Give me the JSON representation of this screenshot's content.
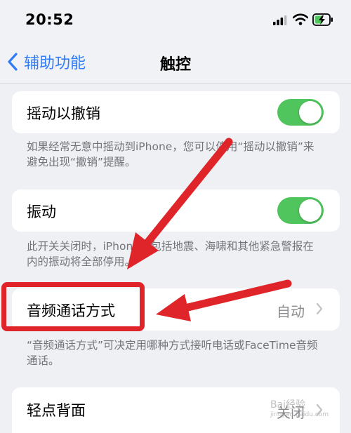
{
  "status_bar": {
    "time": "20:52"
  },
  "nav": {
    "back_label": "辅助功能",
    "title": "触控"
  },
  "shake_to_undo": {
    "label": "摇动以撤销",
    "enabled": true,
    "footer": "如果经常无意中摇动到iPhone，您可以停用“摇动以撤销”来避免出现“撤销”提醒。"
  },
  "vibration": {
    "label": "振动",
    "enabled": true,
    "footer": "此开关关闭时，iPhone上包括地震、海啸和其他紧急警报在内的振动将全部停用。"
  },
  "call_audio_routing": {
    "label": "音频通话方式",
    "value": "自动",
    "footer": "“音频通话方式”可决定用哪种方式接听电话或FaceTime音频通话。"
  },
  "back_tap": {
    "label": "轻点背面",
    "value": "关闭"
  },
  "watermark": {
    "text": "Bai经验",
    "sub": "jingyan.baidu.com"
  },
  "colors": {
    "accent": "#2f7cf6",
    "toggle_on": "#51c55d",
    "annotation": "#e0252a"
  }
}
